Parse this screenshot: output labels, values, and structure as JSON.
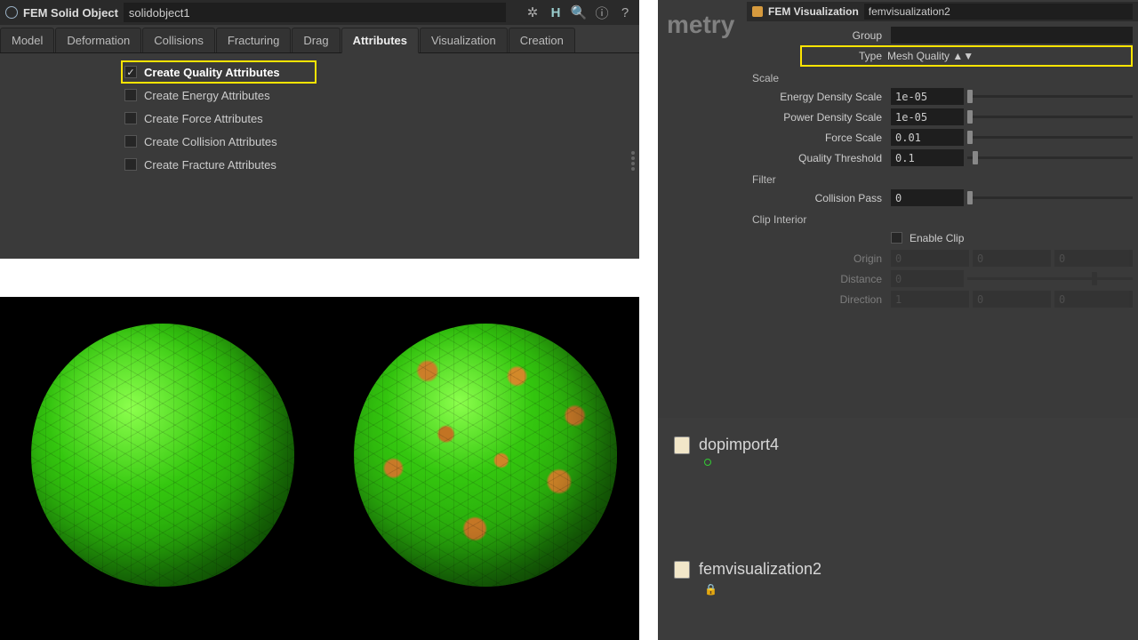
{
  "left": {
    "titlebar": {
      "type_label": "FEM Solid Object",
      "name": "solidobject1"
    },
    "tabs": [
      "Model",
      "Deformation",
      "Collisions",
      "Fracturing",
      "Drag",
      "Attributes",
      "Visualization",
      "Creation"
    ],
    "active_tab": "Attributes",
    "attrs": [
      {
        "label": "Create Quality Attributes",
        "checked": true,
        "hl": true
      },
      {
        "label": "Create Energy Attributes",
        "checked": false
      },
      {
        "label": "Create Force Attributes",
        "checked": false
      },
      {
        "label": "Create Collision Attributes",
        "checked": false
      },
      {
        "label": "Create Fracture Attributes",
        "checked": false
      }
    ]
  },
  "right": {
    "bg_text": "metry",
    "titlebar": {
      "type_label": "FEM Visualization",
      "name": "femvisualization2"
    },
    "group_label": "Group",
    "type_label": "Type",
    "type_value": "Mesh Quality",
    "sections": {
      "scale": "Scale",
      "filter": "Filter",
      "clip": "Clip Interior"
    },
    "params": {
      "energy_density": {
        "label": "Energy Density Scale",
        "value": "1e-05",
        "slider": 0
      },
      "power_density": {
        "label": "Power Density Scale",
        "value": "1e-05",
        "slider": 0
      },
      "force_scale": {
        "label": "Force Scale",
        "value": "0.01",
        "slider": 0
      },
      "quality_threshold": {
        "label": "Quality Threshold",
        "value": "0.1",
        "slider": 3
      },
      "collision_pass": {
        "label": "Collision Pass",
        "value": "0",
        "slider": 0
      },
      "enable_clip": {
        "label": "Enable Clip",
        "checked": false
      },
      "origin": {
        "label": "Origin",
        "v": [
          "0",
          "0",
          "0"
        ]
      },
      "distance": {
        "label": "Distance",
        "value": "0",
        "slider": 75
      },
      "direction": {
        "label": "Direction",
        "v": [
          "1",
          "0",
          "0"
        ]
      }
    },
    "nodes": [
      {
        "name": "dopimport4"
      },
      {
        "name": "femvisualization2"
      }
    ]
  }
}
